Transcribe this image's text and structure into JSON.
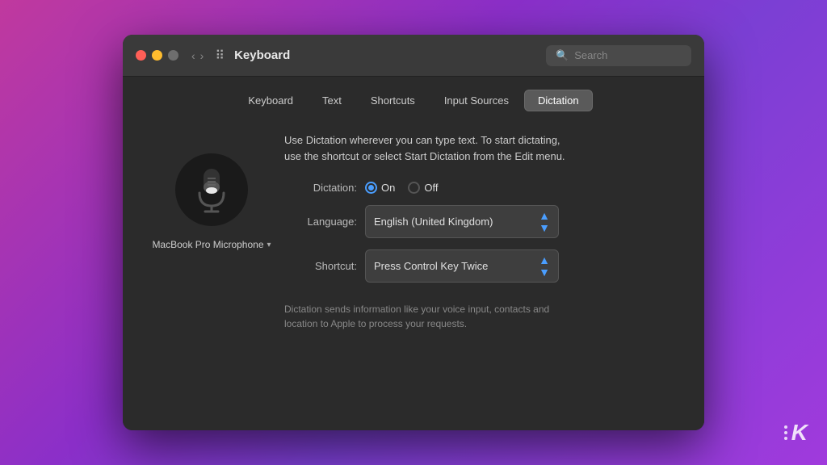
{
  "window": {
    "title": "Keyboard",
    "traffic_lights": {
      "red": "close",
      "yellow": "minimize",
      "green": "maximize"
    }
  },
  "search": {
    "placeholder": "Search"
  },
  "tabs": [
    {
      "id": "keyboard",
      "label": "Keyboard",
      "active": false
    },
    {
      "id": "text",
      "label": "Text",
      "active": false
    },
    {
      "id": "shortcuts",
      "label": "Shortcuts",
      "active": false
    },
    {
      "id": "input-sources",
      "label": "Input Sources",
      "active": false
    },
    {
      "id": "dictation",
      "label": "Dictation",
      "active": true
    }
  ],
  "dictation": {
    "description": "Use Dictation wherever you can type text. To start dictating,\nuse the shortcut or select Start Dictation from the Edit menu.",
    "dictation_label": "Dictation:",
    "on_label": "On",
    "off_label": "Off",
    "on_selected": true,
    "language_label": "Language:",
    "language_value": "English (United Kingdom)",
    "shortcut_label": "Shortcut:",
    "shortcut_value": "Press Control Key Twice",
    "footer_note": "Dictation sends information like your voice input, contacts and\nlocation to Apple to process your requests.",
    "mic_label": "MacBook Pro Microphone"
  }
}
